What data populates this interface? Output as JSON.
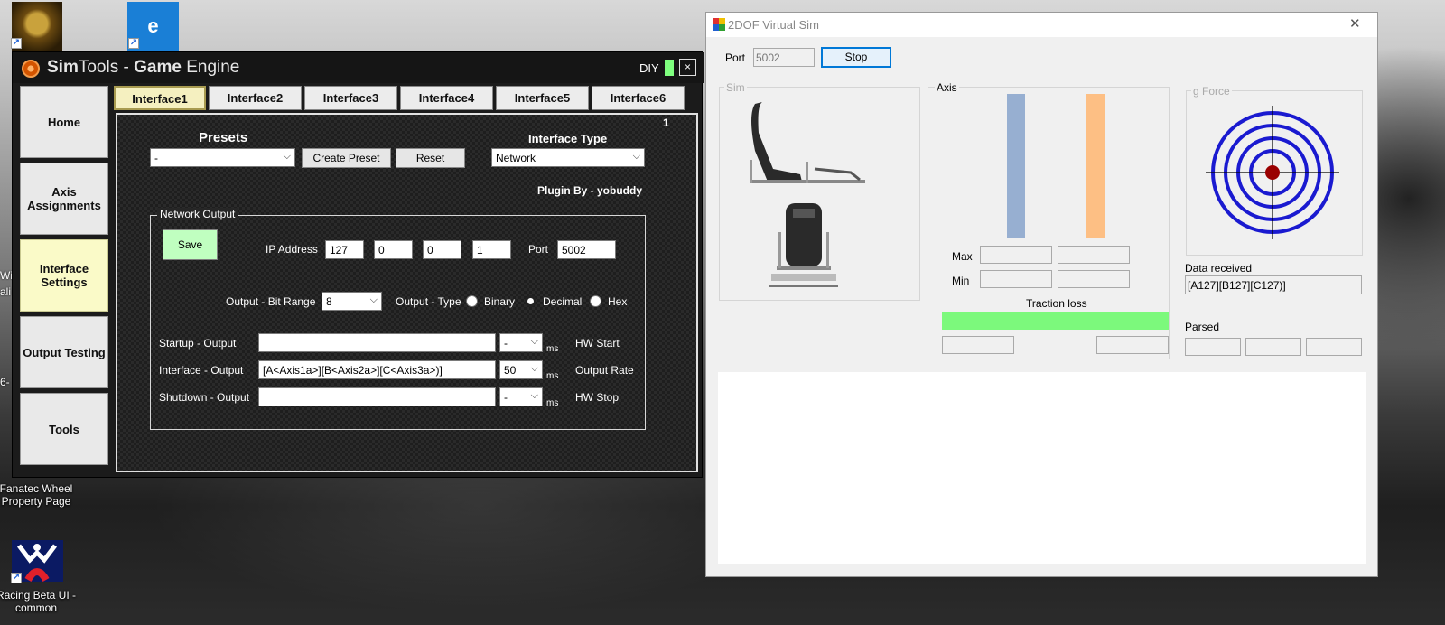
{
  "desktop": {
    "icons": [
      {
        "label": ""
      },
      {
        "label": ""
      },
      {
        "label": "Fanatec Wheel Property Page"
      },
      {
        "label": "Racing Beta UI - common"
      }
    ],
    "partial_text": {
      "a": "Wi",
      "b": "ali",
      "c": "6-"
    }
  },
  "simtools": {
    "title_prefix": "Sim",
    "title_mid": "Tools - ",
    "title_game": "Game",
    "title_suffix": " Engine",
    "diy": "DIY",
    "close_glyph": "×",
    "nav": [
      "Home",
      "Axis Assignments",
      "Interface Settings",
      "Output Testing",
      "Tools"
    ],
    "tabs": [
      "Interface1",
      "Interface2",
      "Interface3",
      "Interface4",
      "Interface5",
      "Interface6"
    ],
    "panel_number": "1",
    "presets_label": "Presets",
    "presets_value": "-",
    "create_preset": "Create Preset",
    "reset": "Reset",
    "interface_type_label": "Interface Type",
    "interface_type_value": "Network",
    "plugin_by": "Plugin By - yobuddy",
    "network_output_label": "Network Output",
    "save": "Save",
    "ip_label": "IP Address",
    "ip": [
      "127",
      "0",
      "0",
      "1"
    ],
    "port_label": "Port",
    "port_value": "5002",
    "bit_range_label": "Output - Bit Range",
    "bit_range_value": "8",
    "output_type_label": "Output - Type",
    "output_types": [
      "Binary",
      "Decimal",
      "Hex"
    ],
    "output_type_selected": "Decimal",
    "startup_label": "Startup - Output",
    "startup_value": "",
    "startup_ms_value": "-",
    "hw_start": "HW Start",
    "interface_label": "Interface - Output",
    "interface_value": "[A<Axis1a>][B<Axis2a>][C<Axis3a>)]",
    "interface_ms_value": "50",
    "output_rate": "Output Rate",
    "shutdown_label": "Shutdown - Output",
    "shutdown_value": "",
    "shutdown_ms_value": "-",
    "hw_stop": "HW Stop",
    "ms": "ms",
    "chevron": "⌵"
  },
  "vsim": {
    "title": "2DOF Virtual Sim",
    "close_glyph": "✕",
    "port_label": "Port",
    "port_value": "5002",
    "stop": "Stop",
    "sim_label": "Sim",
    "axis_label": "Axis",
    "gforce_label": "g Force",
    "max_label": "Max",
    "min_label": "Min",
    "traction_label": "Traction loss",
    "data_received_label": "Data received",
    "data_received_value": "[A127][B127][C127)]",
    "parsed_label": "Parsed",
    "colors": {
      "axis1": "#97afd1",
      "axis2": "#fdbf84",
      "traction": "#7cf97c",
      "target": "#1a1ad0",
      "dot": "#9a0000"
    },
    "axis_levels": {
      "axis1": 1.0,
      "axis2": 1.0,
      "traction": 1.0
    }
  }
}
